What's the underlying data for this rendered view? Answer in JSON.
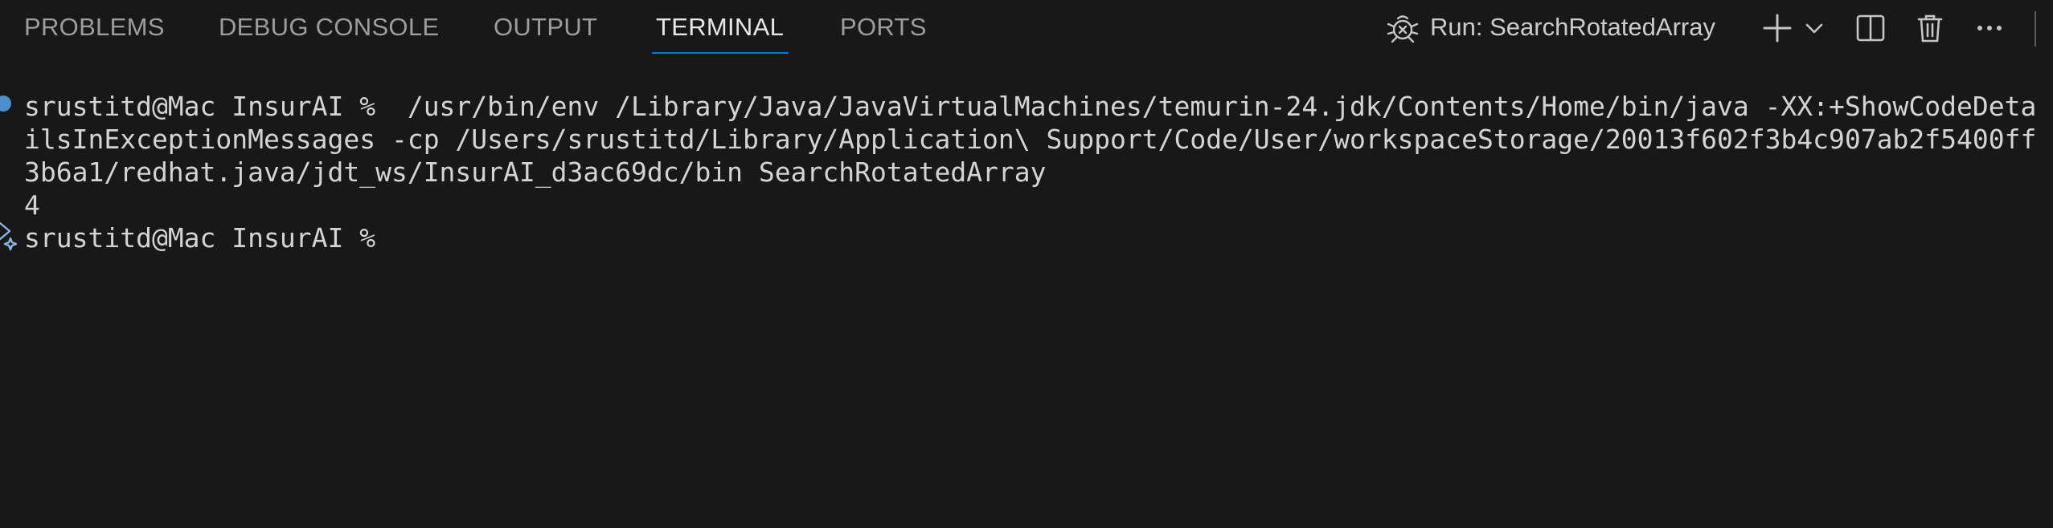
{
  "tabs": [
    {
      "label": "PROBLEMS",
      "active": false
    },
    {
      "label": "DEBUG CONSOLE",
      "active": false
    },
    {
      "label": "OUTPUT",
      "active": false
    },
    {
      "label": "TERMINAL",
      "active": true
    },
    {
      "label": "PORTS",
      "active": false
    }
  ],
  "toolbar": {
    "run_icon": "debug-bug-icon",
    "run_label": "Run: SearchRotatedArray",
    "new_terminal_icon": "plus-icon",
    "dropdown_icon": "chevron-down-icon",
    "split_icon": "split-editor-icon",
    "kill_icon": "trash-icon",
    "more_icon": "ellipsis-icon"
  },
  "terminal": {
    "lines": [
      "srustitd@Mac InsurAI %  /usr/bin/env /Library/Java/JavaVirtualMachines/temurin-24.jdk/Contents/Home/bin/java -XX:+ShowCodeDeta",
      "ilsInExceptionMessages -cp /Users/srustitd/Library/Application\\ Support/Code/User/workspaceStorage/20013f602f3b4c907ab2f5400ff",
      "3b6a1/redhat.java/jdt_ws/InsurAI_d3ac69dc/bin SearchRotatedArray",
      "4",
      "srustitd@Mac InsurAI %"
    ],
    "command_decoration_icon": "command-success-dot-icon",
    "prompt_decoration_icon": "sparkle-prompt-icon"
  },
  "colors": {
    "background": "#181818",
    "active_tab_underline": "#0078d4",
    "decoration_blue": "#4c8fcf"
  }
}
